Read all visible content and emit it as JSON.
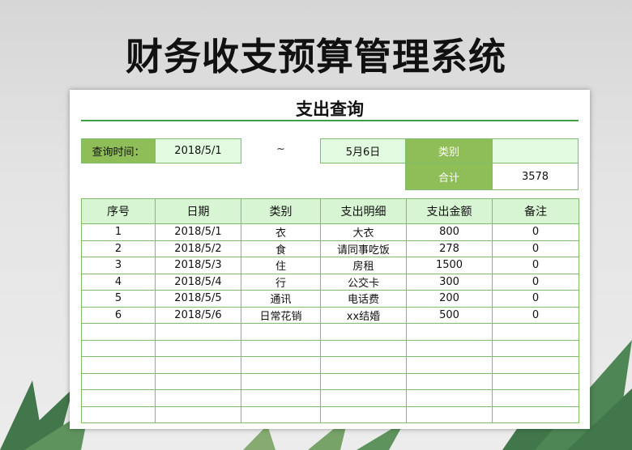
{
  "title": "财务收支预算管理系统",
  "sheet": {
    "heading": "支出查询",
    "query_label": "查询时间：",
    "start_date": "2018/5/1",
    "tilde": "~",
    "end_date": "5月6日",
    "category_label": "类别",
    "category_value": "",
    "total_label": "合计",
    "total_value": "3578"
  },
  "table": {
    "columns": [
      "序号",
      "日期",
      "类别",
      "支出明细",
      "支出金额",
      "备注"
    ],
    "rows": [
      [
        "1",
        "2018/5/1",
        "衣",
        "大衣",
        "800",
        "0"
      ],
      [
        "2",
        "2018/5/2",
        "食",
        "请同事吃饭",
        "278",
        "0"
      ],
      [
        "3",
        "2018/5/3",
        "住",
        "房租",
        "1500",
        "0"
      ],
      [
        "4",
        "2018/5/4",
        "行",
        "公交卡",
        "300",
        "0"
      ],
      [
        "5",
        "2018/5/5",
        "通讯",
        "电话费",
        "200",
        "0"
      ],
      [
        "6",
        "2018/5/6",
        "日常花销",
        "xx结婚",
        "500",
        "0"
      ],
      [
        "",
        "",
        "",
        "",
        "",
        ""
      ],
      [
        "",
        "",
        "",
        "",
        "",
        ""
      ],
      [
        "",
        "",
        "",
        "",
        "",
        ""
      ],
      [
        "",
        "",
        "",
        "",
        "",
        ""
      ],
      [
        "",
        "",
        "",
        "",
        "",
        ""
      ],
      [
        "",
        "",
        "",
        "",
        "",
        ""
      ]
    ]
  },
  "colors": {
    "header_dark": "#8fbd58",
    "light_fill": "#e2fadf",
    "border": "#7ebd6b",
    "title_rule": "#3fa046"
  }
}
